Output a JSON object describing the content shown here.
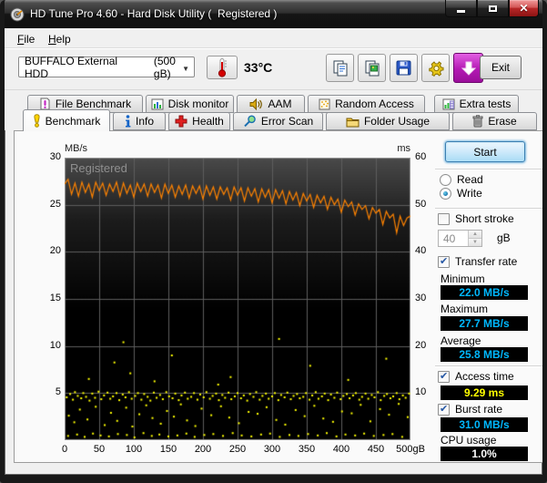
{
  "window": {
    "title": "HD Tune Pro 4.60 - Hard Disk Utility (  Registered )",
    "controls": [
      "minimize",
      "maximize",
      "close"
    ]
  },
  "menu": {
    "items": [
      {
        "label": "File"
      },
      {
        "label": "Help"
      }
    ]
  },
  "toolbar": {
    "drive_name": "BUFFALO External HDD",
    "drive_size": "(500 gB)",
    "temperature": "33°C",
    "buttons": [
      "copy-text",
      "copy-image",
      "save",
      "options",
      "download"
    ],
    "exit_label": "Exit"
  },
  "tabs": {
    "row1": [
      {
        "label": "File Benchmark",
        "icon": "file-benchmark-icon"
      },
      {
        "label": "Disk monitor",
        "icon": "disk-monitor-icon"
      },
      {
        "label": "AAM",
        "icon": "aam-icon"
      },
      {
        "label": "Random Access",
        "icon": "random-access-icon"
      },
      {
        "label": "Extra tests",
        "icon": "extra-tests-icon"
      }
    ],
    "row2": [
      {
        "label": "Benchmark",
        "icon": "benchmark-icon"
      },
      {
        "label": "Info",
        "icon": "info-icon"
      },
      {
        "label": "Health",
        "icon": "health-icon"
      },
      {
        "label": "Error Scan",
        "icon": "error-scan-icon"
      },
      {
        "label": "Folder Usage",
        "icon": "folder-usage-icon"
      },
      {
        "label": "Erase",
        "icon": "erase-icon"
      }
    ],
    "active": "Benchmark"
  },
  "panel": {
    "start_label": "Start",
    "read_label": "Read",
    "write_label": "Write",
    "mode_selected": "Write",
    "short_stroke_label": "Short stroke",
    "short_stroke_checked": false,
    "short_stroke_value": "40",
    "short_stroke_unit": "gB",
    "transfer_rate_label": "Transfer rate",
    "transfer_rate_checked": true,
    "minimum_label": "Minimum",
    "minimum_value": "22.0 MB/s",
    "maximum_label": "Maximum",
    "maximum_value": "27.7 MB/s",
    "average_label": "Average",
    "average_value": "25.8 MB/s",
    "access_time_label": "Access time",
    "access_time_checked": true,
    "access_time_value": "9.29 ms",
    "burst_rate_label": "Burst rate",
    "burst_rate_checked": true,
    "burst_rate_value": "31.0 MB/s",
    "cpu_usage_label": "CPU usage",
    "cpu_usage_value": "1.0%"
  },
  "chart_data": {
    "type": "line+scatter",
    "watermark": "Registered",
    "left_axis": {
      "unit": "MB/s",
      "min": 0,
      "max": 30,
      "ticks": [
        30,
        25,
        20,
        15,
        10,
        5
      ]
    },
    "right_axis": {
      "unit": "ms",
      "min": 0,
      "max": 60,
      "ticks": [
        60,
        50,
        40,
        30,
        20,
        10
      ]
    },
    "x_axis": {
      "min": 0,
      "max": 500,
      "tick_values": [
        0,
        50,
        100,
        150,
        200,
        250,
        300,
        350,
        400,
        450,
        500
      ],
      "tick_labels": [
        "0",
        "50",
        "100",
        "150",
        "200",
        "250",
        "300",
        "350",
        "400",
        "450",
        "500gB"
      ]
    },
    "grid": true,
    "colors": {
      "transfer_rate": "#ff8300",
      "access_time": "#ffff00",
      "grid": "#5d5d5d",
      "plot_bg": "#000000",
      "border": "#9b9b9b"
    },
    "series": [
      {
        "name": "transfer_rate",
        "axis": "left",
        "unit": "MB/s",
        "color": "#ff8300",
        "x_step": 5,
        "values": [
          27.2,
          27.7,
          26.1,
          27.3,
          25.9,
          27.4,
          26.3,
          27.2,
          25.8,
          27.4,
          26.5,
          27.3,
          26.0,
          27.2,
          26.4,
          27.4,
          25.9,
          27.3,
          26.2,
          27.1,
          25.8,
          27.3,
          26.4,
          27.2,
          25.9,
          27.2,
          26.3,
          27.1,
          25.7,
          27.2,
          26.2,
          27.1,
          25.8,
          27.0,
          26.1,
          27.1,
          25.7,
          27.0,
          26.2,
          27.0,
          25.6,
          27.0,
          26.0,
          26.9,
          25.6,
          26.9,
          26.1,
          26.8,
          25.5,
          26.9,
          26.0,
          26.8,
          25.4,
          26.8,
          25.9,
          26.7,
          25.3,
          26.7,
          25.8,
          26.6,
          25.2,
          26.6,
          25.7,
          26.5,
          25.1,
          26.4,
          25.5,
          26.3,
          24.9,
          26.2,
          25.4,
          26.1,
          24.7,
          26.0,
          25.2,
          25.9,
          24.5,
          25.8,
          25.0,
          25.6,
          24.2,
          25.5,
          24.8,
          25.3,
          23.9,
          25.1,
          24.5,
          24.9,
          23.5,
          24.7,
          24.1,
          24.5,
          22.9,
          24.3,
          23.6,
          24.0,
          22.0,
          23.8,
          22.8,
          23.6,
          23.8
        ]
      },
      {
        "name": "access_time",
        "axis": "right",
        "unit": "ms",
        "color": "#ffff00",
        "points": [
          [
            3,
            9.1
          ],
          [
            8,
            9.8
          ],
          [
            12,
            8.6
          ],
          [
            15,
            10.2
          ],
          [
            19,
            9.4
          ],
          [
            24,
            8.9
          ],
          [
            27,
            10.0
          ],
          [
            31,
            9.2
          ],
          [
            36,
            8.4
          ],
          [
            40,
            9.9
          ],
          [
            44,
            9.0
          ],
          [
            49,
            10.3
          ],
          [
            53,
            8.7
          ],
          [
            57,
            9.5
          ],
          [
            62,
            10.1
          ],
          [
            66,
            8.8
          ],
          [
            70,
            9.3
          ],
          [
            75,
            10.0
          ],
          [
            79,
            8.5
          ],
          [
            84,
            9.7
          ],
          [
            88,
            9.1
          ],
          [
            93,
            10.2
          ],
          [
            97,
            8.8
          ],
          [
            102,
            9.4
          ],
          [
            106,
            10.0
          ],
          [
            111,
            8.6
          ],
          [
            115,
            9.8
          ],
          [
            120,
            9.2
          ],
          [
            124,
            8.4
          ],
          [
            129,
            10.1
          ],
          [
            133,
            9.0
          ],
          [
            138,
            9.6
          ],
          [
            142,
            8.7
          ],
          [
            147,
            10.2
          ],
          [
            151,
            9.3
          ],
          [
            156,
            8.9
          ],
          [
            160,
            9.9
          ],
          [
            165,
            8.5
          ],
          [
            169,
            9.5
          ],
          [
            174,
            10.1
          ],
          [
            178,
            8.8
          ],
          [
            183,
            9.2
          ],
          [
            187,
            10.0
          ],
          [
            192,
            8.6
          ],
          [
            196,
            9.7
          ],
          [
            201,
            9.1
          ],
          [
            205,
            10.2
          ],
          [
            210,
            8.8
          ],
          [
            214,
            9.4
          ],
          [
            219,
            9.9
          ],
          [
            223,
            8.5
          ],
          [
            228,
            9.6
          ],
          [
            232,
            9.0
          ],
          [
            237,
            10.1
          ],
          [
            241,
            8.7
          ],
          [
            246,
            9.3
          ],
          [
            250,
            10.0
          ],
          [
            255,
            8.9
          ],
          [
            259,
            9.5
          ],
          [
            264,
            8.4
          ],
          [
            268,
            9.8
          ],
          [
            273,
            9.2
          ],
          [
            277,
            10.2
          ],
          [
            282,
            8.6
          ],
          [
            286,
            9.4
          ],
          [
            291,
            9.9
          ],
          [
            295,
            8.8
          ],
          [
            300,
            9.3
          ],
          [
            304,
            10.0
          ],
          [
            309,
            8.5
          ],
          [
            313,
            9.6
          ],
          [
            318,
            9.1
          ],
          [
            322,
            10.1
          ],
          [
            327,
            8.7
          ],
          [
            331,
            9.4
          ],
          [
            336,
            9.8
          ],
          [
            340,
            8.9
          ],
          [
            345,
            9.2
          ],
          [
            349,
            10.0
          ],
          [
            354,
            8.6
          ],
          [
            358,
            9.5
          ],
          [
            363,
            10.2
          ],
          [
            367,
            8.8
          ],
          [
            372,
            9.3
          ],
          [
            376,
            9.9
          ],
          [
            381,
            8.5
          ],
          [
            385,
            9.7
          ],
          [
            390,
            9.0
          ],
          [
            394,
            10.1
          ],
          [
            399,
            8.7
          ],
          [
            403,
            9.4
          ],
          [
            408,
            9.8
          ],
          [
            412,
            8.9
          ],
          [
            417,
            9.5
          ],
          [
            421,
            10.0
          ],
          [
            426,
            8.6
          ],
          [
            430,
            9.2
          ],
          [
            435,
            9.9
          ],
          [
            439,
            8.8
          ],
          [
            444,
            9.6
          ],
          [
            448,
            9.1
          ],
          [
            453,
            10.2
          ],
          [
            457,
            8.5
          ],
          [
            462,
            9.4
          ],
          [
            466,
            9.8
          ],
          [
            471,
            8.9
          ],
          [
            475,
            9.3
          ],
          [
            480,
            10.0
          ],
          [
            484,
            8.7
          ],
          [
            489,
            9.5
          ],
          [
            493,
            9.0
          ],
          [
            498,
            9.9
          ],
          [
            6,
            5.2
          ],
          [
            14,
            3.8
          ],
          [
            22,
            6.5
          ],
          [
            33,
            4.4
          ],
          [
            45,
            7.1
          ],
          [
            58,
            3.2
          ],
          [
            67,
            5.8
          ],
          [
            76,
            4.1
          ],
          [
            89,
            6.9
          ],
          [
            98,
            2.9
          ],
          [
            108,
            5.5
          ],
          [
            118,
            7.4
          ],
          [
            127,
            4.7
          ],
          [
            139,
            3.5
          ],
          [
            148,
            6.2
          ],
          [
            158,
            5.0
          ],
          [
            168,
            7.6
          ],
          [
            177,
            4.2
          ],
          [
            189,
            3.0
          ],
          [
            198,
            6.7
          ],
          [
            212,
            5.3
          ],
          [
            226,
            7.2
          ],
          [
            238,
            4.8
          ],
          [
            252,
            3.6
          ],
          [
            266,
            6.0
          ],
          [
            279,
            5.6
          ],
          [
            292,
            7.0
          ],
          [
            306,
            4.3
          ],
          [
            319,
            3.3
          ],
          [
            334,
            6.4
          ],
          [
            347,
            5.1
          ],
          [
            361,
            7.3
          ],
          [
            374,
            4.6
          ],
          [
            388,
            3.9
          ],
          [
            401,
            6.1
          ],
          [
            415,
            5.7
          ],
          [
            428,
            7.5
          ],
          [
            442,
            4.0
          ],
          [
            456,
            6.6
          ],
          [
            469,
            5.4
          ],
          [
            483,
            7.7
          ],
          [
            496,
            4.9
          ],
          [
            5,
            0.9
          ],
          [
            18,
            1.2
          ],
          [
            29,
            0.7
          ],
          [
            41,
            1.4
          ],
          [
            52,
            1.0
          ],
          [
            64,
            0.8
          ],
          [
            77,
            1.3
          ],
          [
            90,
            1.1
          ],
          [
            101,
            0.6
          ],
          [
            114,
            1.5
          ],
          [
            126,
            0.9
          ],
          [
            137,
            1.2
          ],
          [
            150,
            0.8
          ],
          [
            163,
            1.0
          ],
          [
            176,
            1.4
          ],
          [
            188,
            0.7
          ],
          [
            202,
            1.1
          ],
          [
            215,
            1.3
          ],
          [
            229,
            0.9
          ],
          [
            243,
            1.5
          ],
          [
            256,
            1.0
          ],
          [
            270,
            0.8
          ],
          [
            284,
            1.2
          ],
          [
            297,
            1.4
          ],
          [
            311,
            0.7
          ],
          [
            325,
            1.1
          ],
          [
            338,
            0.9
          ],
          [
            352,
            1.3
          ],
          [
            366,
            1.0
          ],
          [
            379,
            1.5
          ],
          [
            393,
            0.8
          ],
          [
            406,
            1.2
          ],
          [
            420,
            1.0
          ],
          [
            433,
            1.4
          ],
          [
            447,
            0.9
          ],
          [
            461,
            1.1
          ],
          [
            474,
            1.3
          ],
          [
            488,
            0.7
          ],
          [
            35,
            13.0
          ],
          [
            72,
            16.5
          ],
          [
            85,
            20.8
          ],
          [
            95,
            14.2
          ],
          [
            130,
            12.5
          ],
          [
            155,
            18.0
          ],
          [
            222,
            11.8
          ],
          [
            240,
            13.4
          ],
          [
            310,
            21.5
          ],
          [
            355,
            15.8
          ],
          [
            410,
            12.8
          ],
          [
            465,
            17.3
          ]
        ]
      }
    ]
  }
}
